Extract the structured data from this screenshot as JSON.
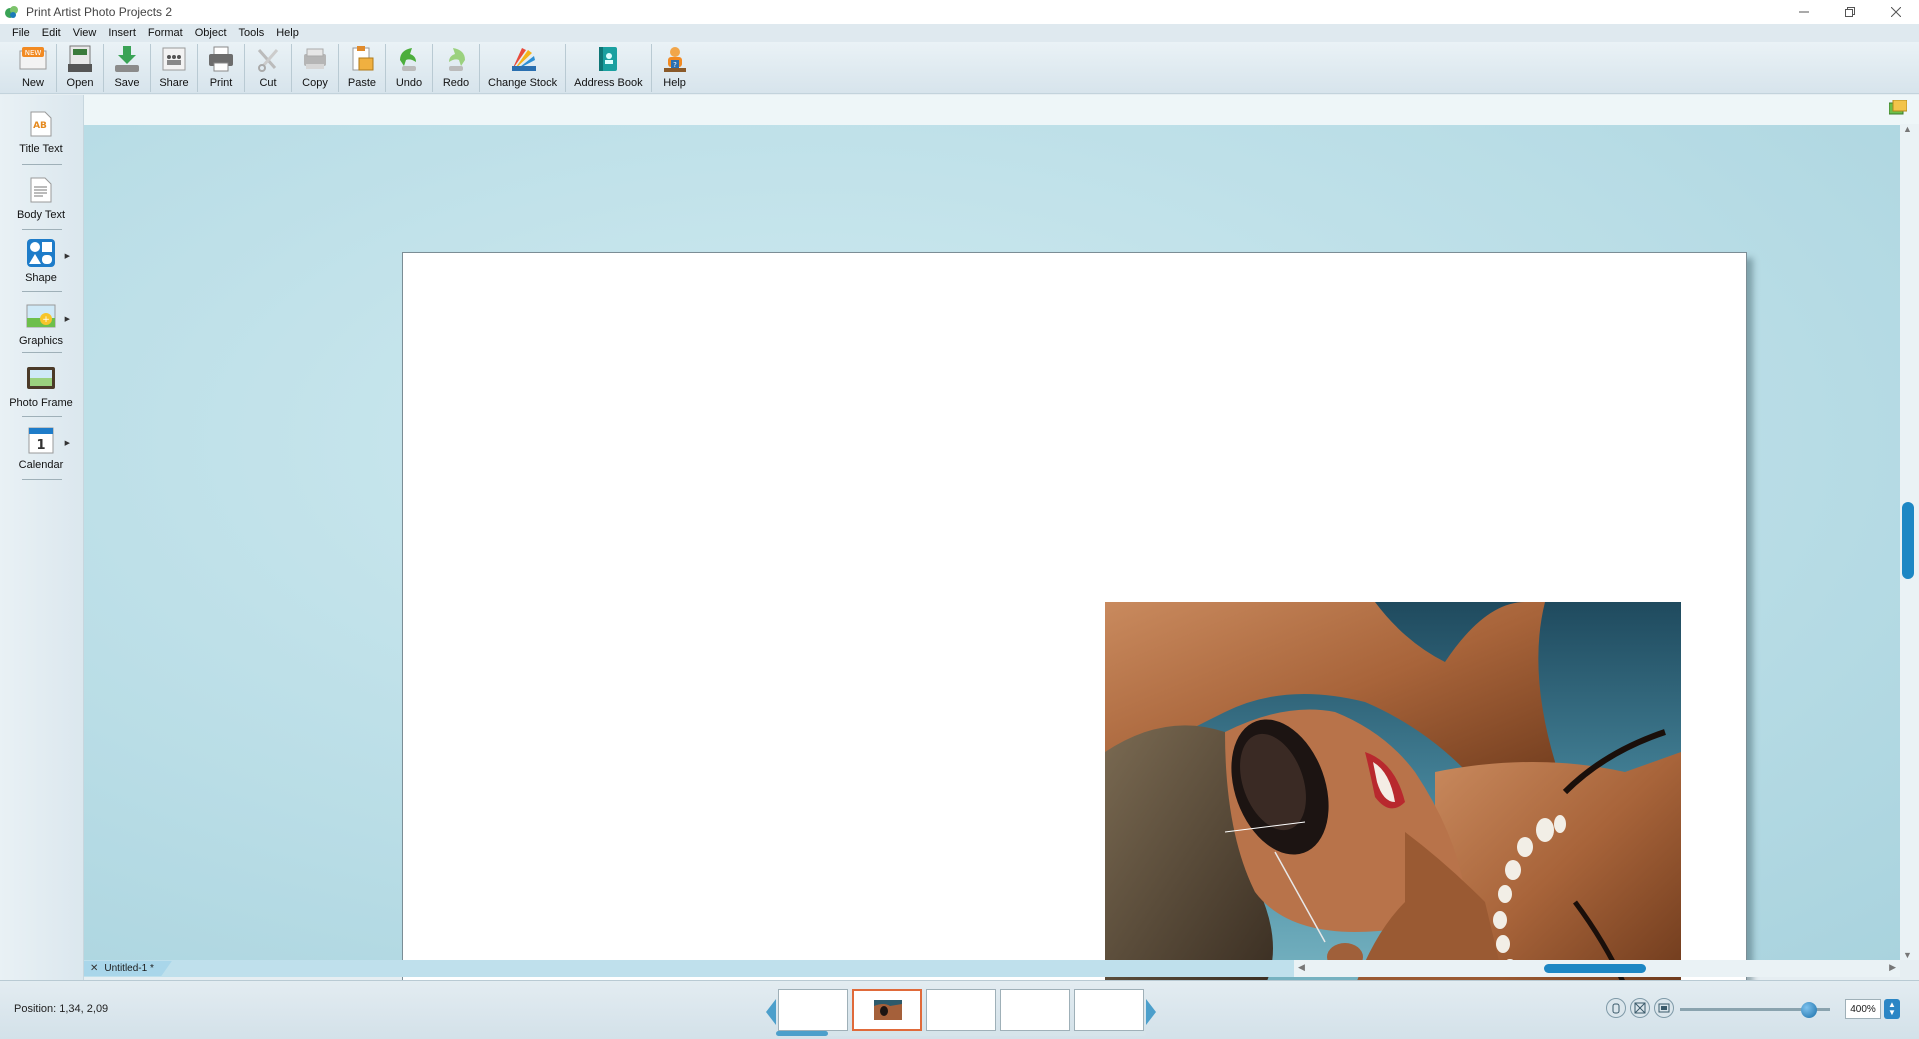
{
  "window": {
    "title": "Print Artist Photo Projects 2",
    "controls": [
      "minimize",
      "restore",
      "close"
    ]
  },
  "menu": [
    "File",
    "Edit",
    "View",
    "Insert",
    "Format",
    "Object",
    "Tools",
    "Help"
  ],
  "toolbar": {
    "new": "New",
    "open": "Open",
    "save": "Save",
    "share": "Share",
    "print": "Print",
    "cut": "Cut",
    "copy": "Copy",
    "paste": "Paste",
    "undo": "Undo",
    "redo": "Redo",
    "change_stock": "Change Stock",
    "address_book": "Address Book",
    "help": "Help"
  },
  "palette": {
    "title_text": "Title Text",
    "body_text": "Body Text",
    "shape": "Shape",
    "graphics": "Graphics",
    "photo_frame": "Photo Frame",
    "calendar": "Calendar"
  },
  "document": {
    "tab_label": "Untitled-1 *",
    "photo_subject": "woman in sunglasses with shell necklace lying in sun"
  },
  "status": {
    "position": "Position: 1,34, 2,09",
    "zoom": "400%",
    "zoom_fraction": 0.9,
    "thumbnail_count": 5,
    "active_thumbnail": 2,
    "thumbnail_scroll_fraction": 0.14
  },
  "colors": {
    "accent": "#1d87c4",
    "active_thumb_border": "#e06a3a",
    "canvas_bg": "#b9dde6"
  }
}
